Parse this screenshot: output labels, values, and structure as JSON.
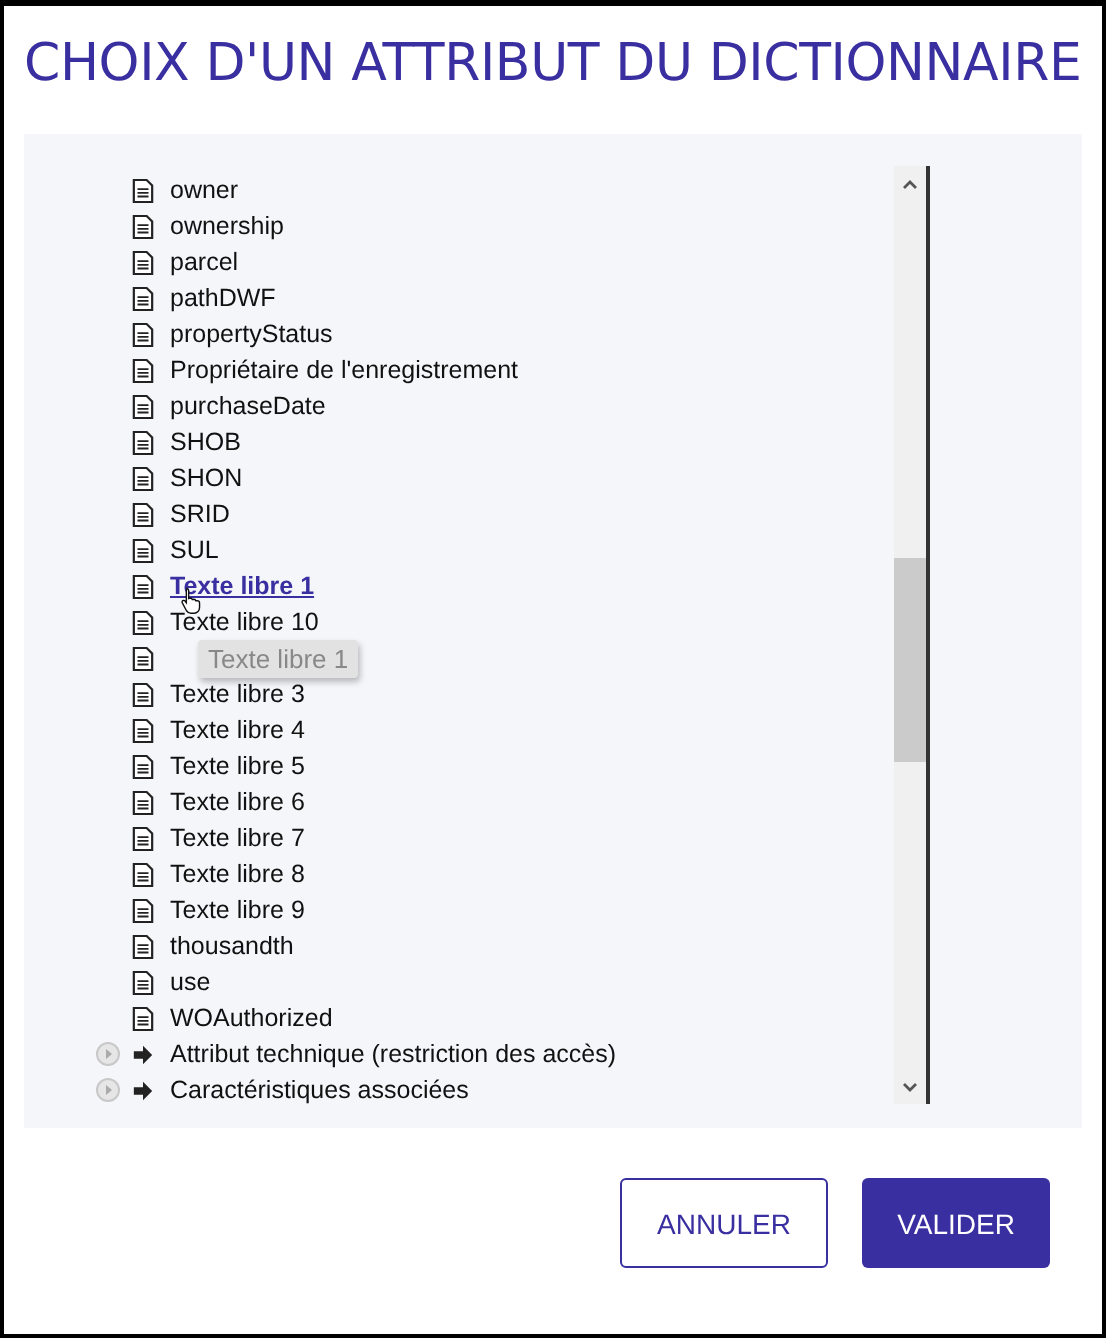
{
  "dialog": {
    "title": "CHOIX D'UN ATTRIBUT DU DICTIONNAIRE"
  },
  "tree": {
    "items": [
      {
        "kind": "file",
        "label": "owner",
        "hovered": false
      },
      {
        "kind": "file",
        "label": "ownership",
        "hovered": false
      },
      {
        "kind": "file",
        "label": "parcel",
        "hovered": false
      },
      {
        "kind": "file",
        "label": "pathDWF",
        "hovered": false
      },
      {
        "kind": "file",
        "label": "propertyStatus",
        "hovered": false
      },
      {
        "kind": "file",
        "label": "Propriétaire de l'enregistrement",
        "hovered": false
      },
      {
        "kind": "file",
        "label": "purchaseDate",
        "hovered": false
      },
      {
        "kind": "file",
        "label": "SHOB",
        "hovered": false
      },
      {
        "kind": "file",
        "label": "SHON",
        "hovered": false
      },
      {
        "kind": "file",
        "label": "SRID",
        "hovered": false
      },
      {
        "kind": "file",
        "label": "SUL",
        "hovered": false
      },
      {
        "kind": "file",
        "label": "Texte libre 1",
        "hovered": true
      },
      {
        "kind": "file",
        "label": "Texte libre 10",
        "hovered": false
      },
      {
        "kind": "file"
      },
      {
        "kind": "file",
        "label": "Texte libre 3",
        "hovered": false
      },
      {
        "kind": "file",
        "label": "Texte libre 4",
        "hovered": false
      },
      {
        "kind": "file",
        "label": "Texte libre 5",
        "hovered": false
      },
      {
        "kind": "file",
        "label": "Texte libre 6",
        "hovered": false
      },
      {
        "kind": "file",
        "label": "Texte libre 7",
        "hovered": false
      },
      {
        "kind": "file",
        "label": "Texte libre 8",
        "hovered": false
      },
      {
        "kind": "file",
        "label": "Texte libre 9",
        "hovered": false
      },
      {
        "kind": "file",
        "label": "thousandth",
        "hovered": false
      },
      {
        "kind": "file",
        "label": "use",
        "hovered": false
      },
      {
        "kind": "file",
        "label": "WOAuthorized",
        "hovered": false
      },
      {
        "kind": "folder",
        "label": "Attribut technique (restriction des accès)",
        "hovered": false,
        "expanded": false
      },
      {
        "kind": "folder",
        "label": "Caractéristiques associées",
        "hovered": false,
        "expanded": false
      }
    ],
    "tooltip": {
      "text": "Texte libre 1"
    }
  },
  "buttons": [
    {
      "label": "ANNULER",
      "kind": "secondary"
    },
    {
      "label": "VALIDER",
      "kind": "primary"
    }
  ]
}
